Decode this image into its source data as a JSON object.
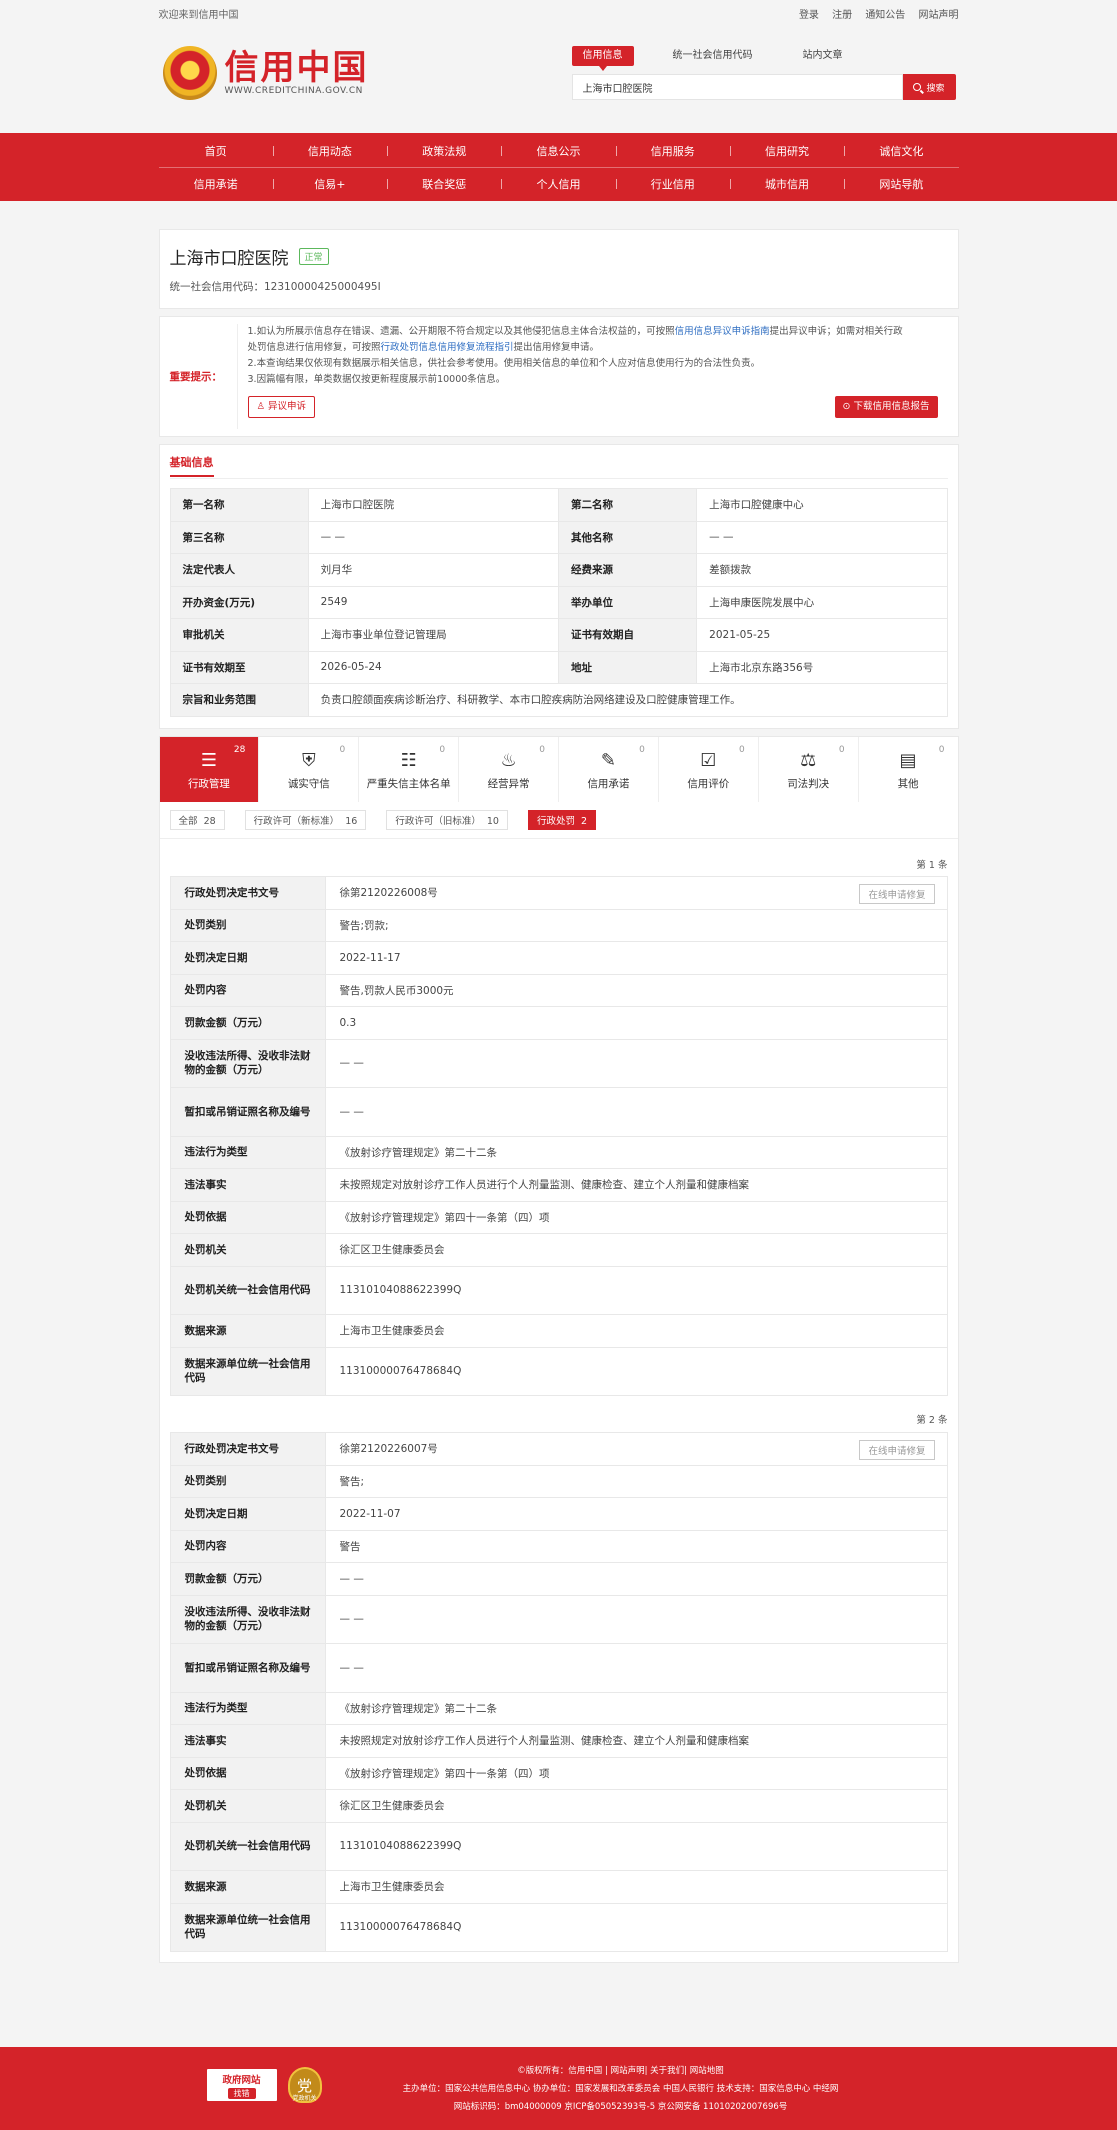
{
  "topbar": {
    "welcome": "欢迎来到信用中国",
    "links": [
      "登录",
      "注册",
      "通知公告",
      "网站声明"
    ]
  },
  "logo": {
    "cn": "信用中国",
    "en": "WWW.CREDITCHINA.GOV.CN"
  },
  "search": {
    "tabs": [
      "信用信息",
      "统一社会信用代码",
      "站内文章"
    ],
    "value": "上海市口腔医院",
    "button": "搜索"
  },
  "nav": {
    "row1": [
      "首页",
      "信用动态",
      "政策法规",
      "信息公示",
      "信用服务",
      "信用研究",
      "诚信文化"
    ],
    "row2": [
      "信用承诺",
      "信易+",
      "联合奖惩",
      "个人信用",
      "行业信用",
      "城市信用",
      "网站导航"
    ]
  },
  "entity": {
    "name": "上海市口腔医院",
    "status": "正常",
    "ucc": "统一社会信用代码：12310000425000495I"
  },
  "notice": {
    "label": "重要提示：",
    "line1_a": "1.如认为所展示信息存在错误、遗漏、公开期限不符合规定以及其他侵犯信息主体合法权益的，可按照",
    "line1_link": "信用信息异议申诉指南",
    "line1_b": "提出异议申诉；如需对相关行政",
    "line1c_a": "处罚信息进行信用修复，可按照",
    "line1c_link": "行政处罚信息信用修复流程指引",
    "line1c_b": "提出信用修复申请。",
    "line2": "2.本查询结果仅依现有数据展示相关信息，供社会参考使用。使用相关信息的单位和个人应对信息使用行为的合法性负责。",
    "line3": "3.因篇幅有限，单类数据仅按更新程度展示前10000条信息。",
    "objection_btn": "异议申诉",
    "download_btn": "下载信用信息报告"
  },
  "basic": {
    "title": "基础信息",
    "rows": [
      {
        "k1": "第一名称",
        "v1": "上海市口腔医院",
        "k2": "第二名称",
        "v2": "上海市口腔健康中心"
      },
      {
        "k1": "第三名称",
        "v1": "— —",
        "k2": "其他名称",
        "v2": "— —"
      },
      {
        "k1": "法定代表人",
        "v1": "刘月华",
        "k2": "经费来源",
        "v2": "差额拨款"
      },
      {
        "k1": "开办资金(万元)",
        "v1": "2549",
        "k2": "举办单位",
        "v2": "上海申康医院发展中心"
      },
      {
        "k1": "审批机关",
        "v1": "上海市事业单位登记管理局",
        "k2": "证书有效期自",
        "v2": "2021-05-25"
      },
      {
        "k1": "证书有效期至",
        "v1": "2026-05-24",
        "k2": "地址",
        "v2": "上海市北京东路356号"
      }
    ],
    "scope_k": "宗旨和业务范围",
    "scope_v": "负责口腔颌面疾病诊断治疗、科研教学、本市口腔疾病防治网络建设及口腔健康管理工作。"
  },
  "categories": [
    {
      "label": "行政管理",
      "count": "28",
      "icon": "document-list-icon"
    },
    {
      "label": "诚实守信",
      "count": "0",
      "icon": "shield-icon"
    },
    {
      "label": "严重失信主体名单",
      "count": "0",
      "icon": "blacklist-icon"
    },
    {
      "label": "经营异常",
      "count": "0",
      "icon": "alarm-icon"
    },
    {
      "label": "信用承诺",
      "count": "0",
      "icon": "promise-icon"
    },
    {
      "label": "信用评价",
      "count": "0",
      "icon": "evaluation-icon"
    },
    {
      "label": "司法判决",
      "count": "0",
      "icon": "judgement-icon"
    },
    {
      "label": "其他",
      "count": "0",
      "icon": "other-icon"
    }
  ],
  "filters": [
    {
      "label": "全部",
      "count": "28"
    },
    {
      "label": "行政许可（新标准）",
      "count": "16"
    },
    {
      "label": "行政许可（旧标准）",
      "count": "10"
    },
    {
      "label": "行政处罚",
      "count": "2"
    }
  ],
  "repair_btn": "在线申请修复",
  "records": [
    {
      "index": "第 1 条",
      "rows": [
        {
          "k": "行政处罚决定书文号",
          "v": "徐第2120226008号"
        },
        {
          "k": "处罚类别",
          "v": "警告;罚款;"
        },
        {
          "k": "处罚决定日期",
          "v": "2022-11-17"
        },
        {
          "k": "处罚内容",
          "v": "警告,罚款人民币3000元"
        },
        {
          "k": "罚款金额（万元）",
          "v": "0.3"
        },
        {
          "k": "没收违法所得、没收非法财物的金额（万元）",
          "v": "— —"
        },
        {
          "k": "暂扣或吊销证照名称及编号",
          "v": "— —"
        },
        {
          "k": "违法行为类型",
          "v": "《放射诊疗管理规定》第二十二条"
        },
        {
          "k": "违法事实",
          "v": "未按照规定对放射诊疗工作人员进行个人剂量监测、健康检查、建立个人剂量和健康档案"
        },
        {
          "k": "处罚依据",
          "v": "《放射诊疗管理规定》第四十一条第（四）项"
        },
        {
          "k": "处罚机关",
          "v": "徐汇区卫生健康委员会"
        },
        {
          "k": "处罚机关统一社会信用代码",
          "v": "11310104088622399Q"
        },
        {
          "k": "数据来源",
          "v": "上海市卫生健康委员会"
        },
        {
          "k": "数据来源单位统一社会信用代码",
          "v": "11310000076478684Q"
        }
      ]
    },
    {
      "index": "第 2 条",
      "rows": [
        {
          "k": "行政处罚决定书文号",
          "v": "徐第2120226007号"
        },
        {
          "k": "处罚类别",
          "v": "警告;"
        },
        {
          "k": "处罚决定日期",
          "v": "2022-11-07"
        },
        {
          "k": "处罚内容",
          "v": "警告"
        },
        {
          "k": "罚款金额（万元）",
          "v": "— —"
        },
        {
          "k": "没收违法所得、没收非法财物的金额（万元）",
          "v": "— —"
        },
        {
          "k": "暂扣或吊销证照名称及编号",
          "v": "— —"
        },
        {
          "k": "违法行为类型",
          "v": "《放射诊疗管理规定》第二十二条"
        },
        {
          "k": "违法事实",
          "v": "未按照规定对放射诊疗工作人员进行个人剂量监测、健康检查、建立个人剂量和健康档案"
        },
        {
          "k": "处罚依据",
          "v": "《放射诊疗管理规定》第四十一条第（四）项"
        },
        {
          "k": "处罚机关",
          "v": "徐汇区卫生健康委员会"
        },
        {
          "k": "处罚机关统一社会信用代码",
          "v": "11310104088622399Q"
        },
        {
          "k": "数据来源",
          "v": "上海市卫生健康委员会"
        },
        {
          "k": "数据来源单位统一社会信用代码",
          "v": "11310000076478684Q"
        }
      ]
    }
  ],
  "footer": {
    "badge_top": "政府网站",
    "badge_bottom": "找错",
    "seal": "党",
    "seal_sub": "党政机关",
    "line1": "©版权所有：信用中国 | 网站声明| 关于我们| 网站地图",
    "line2": "主办单位：国家公共信用信息中心   协办单位：国家发展和改革委员会 中国人民银行   技术支持：国家信息中心 中经网",
    "line3": "网站标识码：bm04000009   京ICP备05052393号-5   京公网安备 11010202007696号"
  },
  "colors": {
    "brand_red": "#d42329",
    "status_green": "#5cb85c",
    "link_blue": "#2f6ec2"
  }
}
